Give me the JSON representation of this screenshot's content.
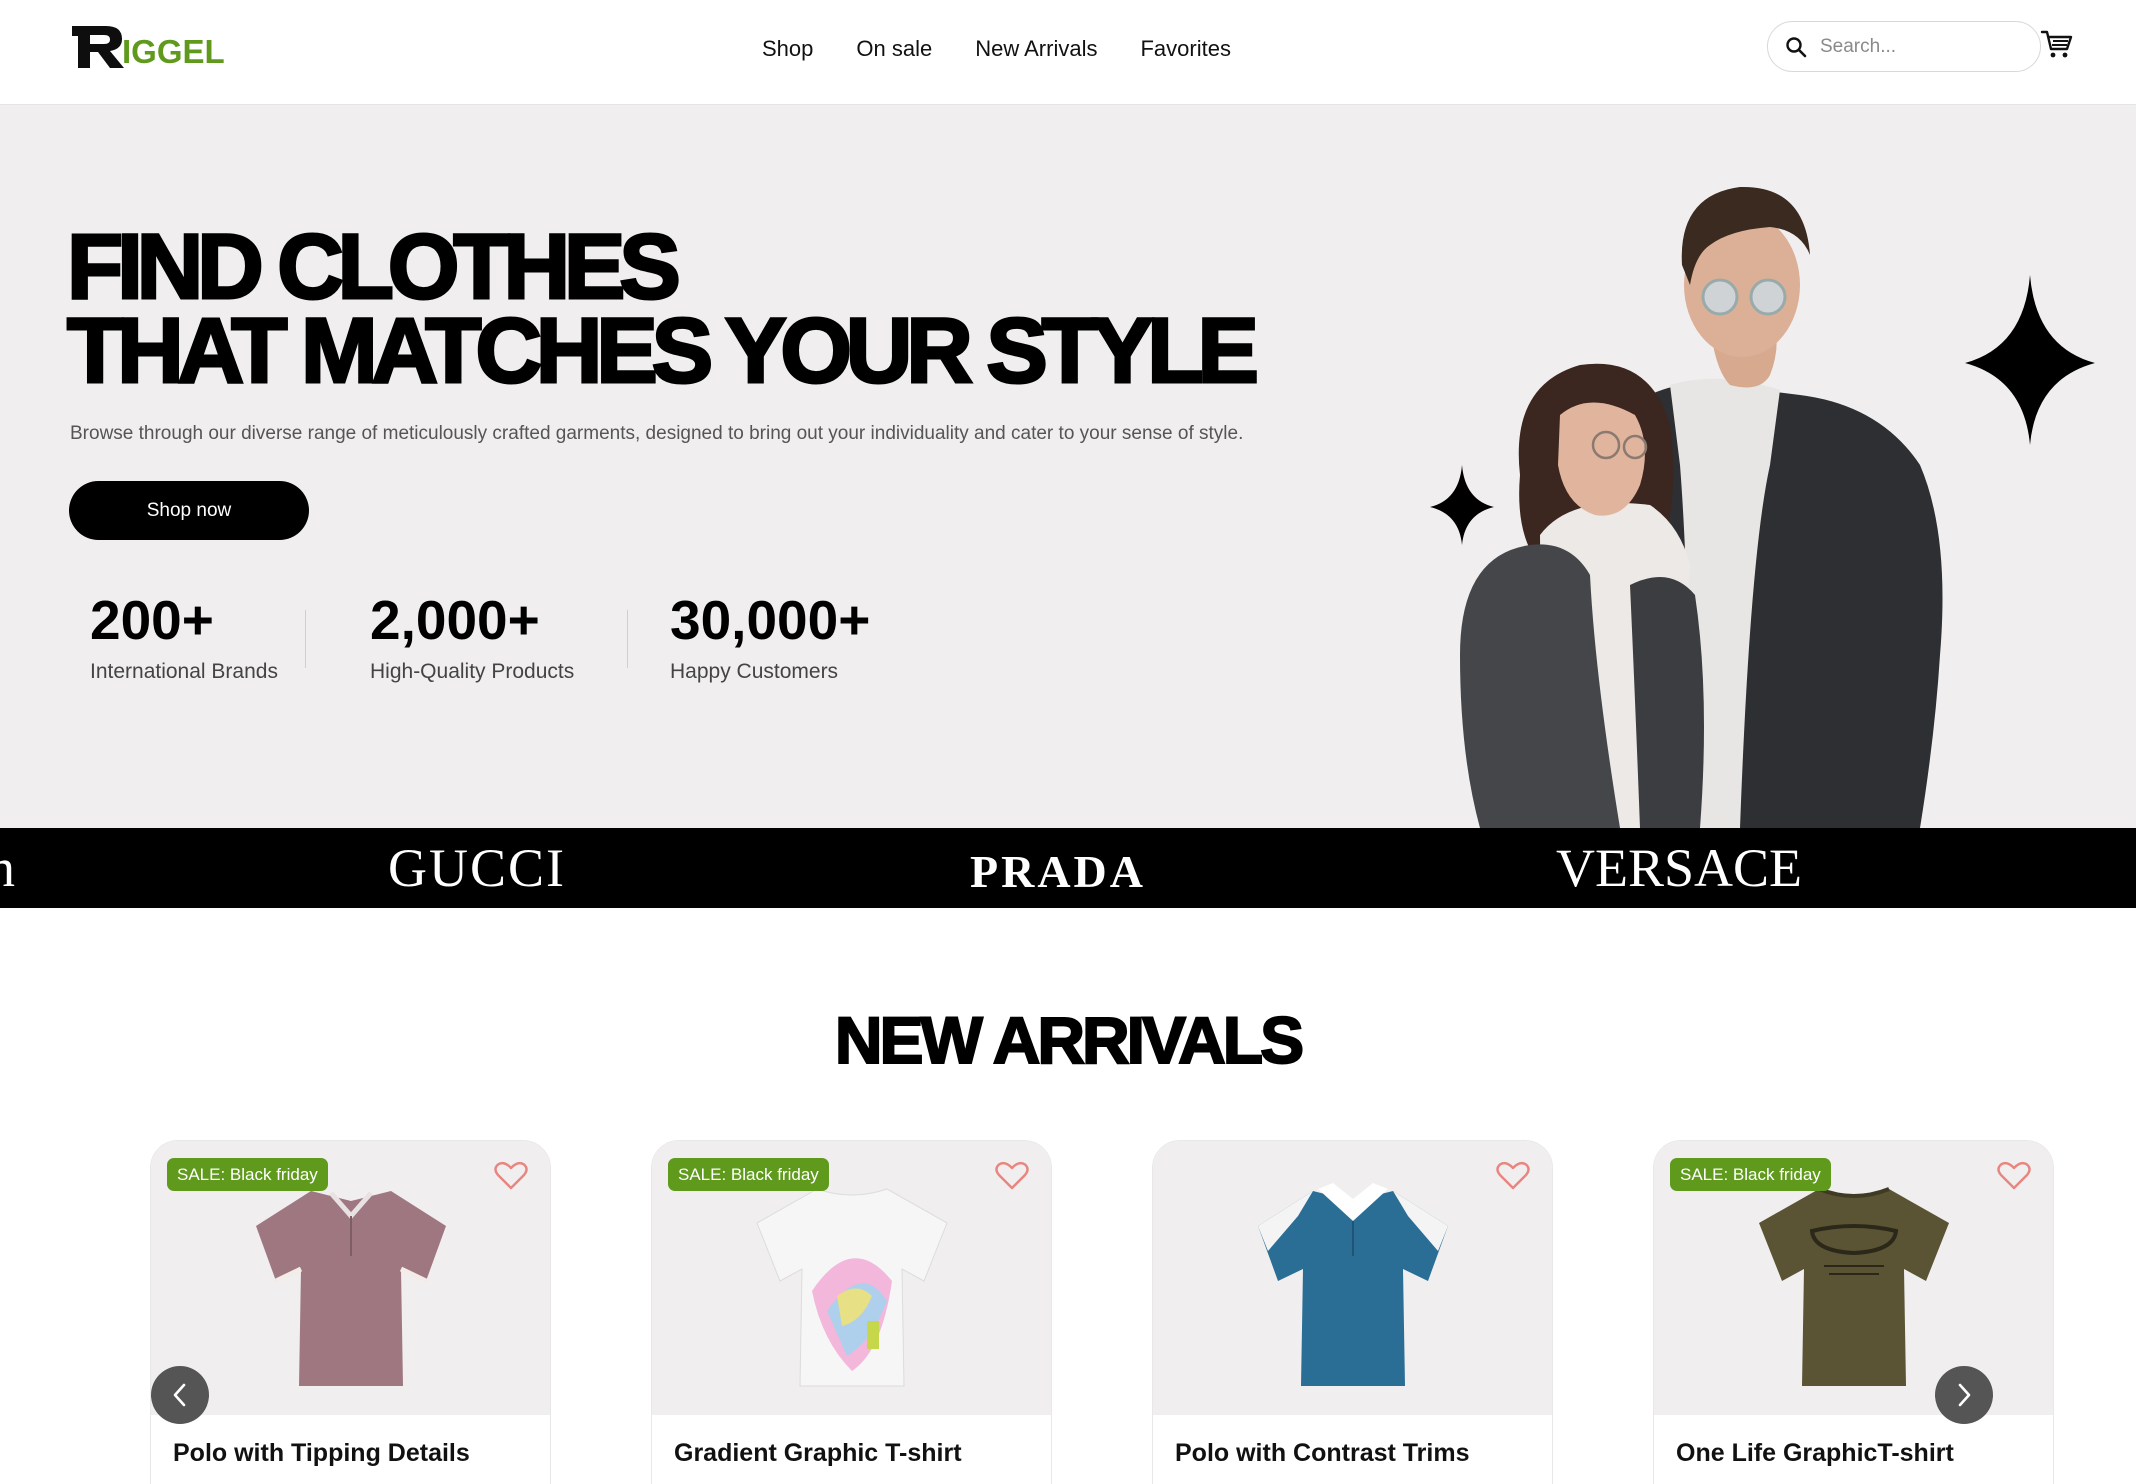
{
  "brand": {
    "logo_text": "IGGEL",
    "logo_letter": "R"
  },
  "nav": {
    "links": [
      "Shop",
      "On sale",
      "New Arrivals",
      "Favorites"
    ]
  },
  "search": {
    "placeholder": "Search..."
  },
  "hero": {
    "title_line1": "FIND CLOTHES",
    "title_line2": "THAT MATCHES YOUR STYLE",
    "subtitle": "Browse through our diverse range of meticulously crafted garments, designed to bring out your individuality and cater to your sense of style.",
    "cta": "Shop now",
    "stats": [
      {
        "value": "200+",
        "label": "International Brands"
      },
      {
        "value": "2,000+",
        "label": "High-Quality Products"
      },
      {
        "value": "30,000+",
        "label": "Happy Customers"
      }
    ]
  },
  "brands": [
    "n",
    "GUCCI",
    "PRADA",
    "VERSACE"
  ],
  "new_arrivals": {
    "title": "NEW ARRIVALS",
    "products": [
      {
        "name": "Polo with Tipping Details",
        "badge": "SALE: Black friday",
        "color": "#a07a84"
      },
      {
        "name": "Gradient Graphic T-shirt",
        "badge": "SALE: Black friday",
        "color": "#f4f4f4"
      },
      {
        "name": "Polo with Contrast Trims",
        "badge": "",
        "color": "#2a6e96"
      },
      {
        "name": "One Life GraphicT-shirt",
        "badge": "SALE: Black friday",
        "color": "#5a5434"
      }
    ]
  },
  "colors": {
    "accent": "#5f9a1d",
    "hero_bg": "#f0eeef",
    "heart": "#e8857f"
  }
}
